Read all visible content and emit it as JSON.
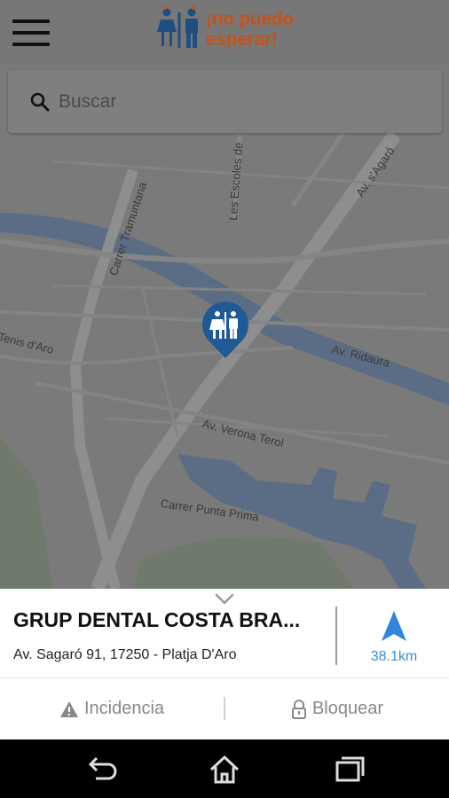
{
  "app": {
    "logo_text_line1": "¡no puedo",
    "logo_text_line2": "esperar!",
    "brand_color": "#c8511a"
  },
  "search": {
    "placeholder": "Buscar",
    "value": ""
  },
  "map": {
    "streets": [
      "Carrer Tramuntana",
      "Les Escoles de",
      "Av. s'Agaró",
      "Tenis d'Aro",
      "Av. Ridaura",
      "Av. Verona Terol",
      "Carrer Punta Prima"
    ],
    "pin_icon": "toilet-icon",
    "pin_color": "#1f5a96"
  },
  "place": {
    "name": "GRUP DENTAL COSTA BRA...",
    "address": "Av. Sagaró 91, 17250 - Platja D'Aro",
    "distance": "38.1km",
    "accent_color": "#3a8fd7"
  },
  "actions": {
    "incidencia_label": "Incidencia",
    "bloquear_label": "Bloquear"
  },
  "system_nav": {
    "back_icon": "back-icon",
    "home_icon": "home-icon",
    "recents_icon": "recents-icon"
  }
}
